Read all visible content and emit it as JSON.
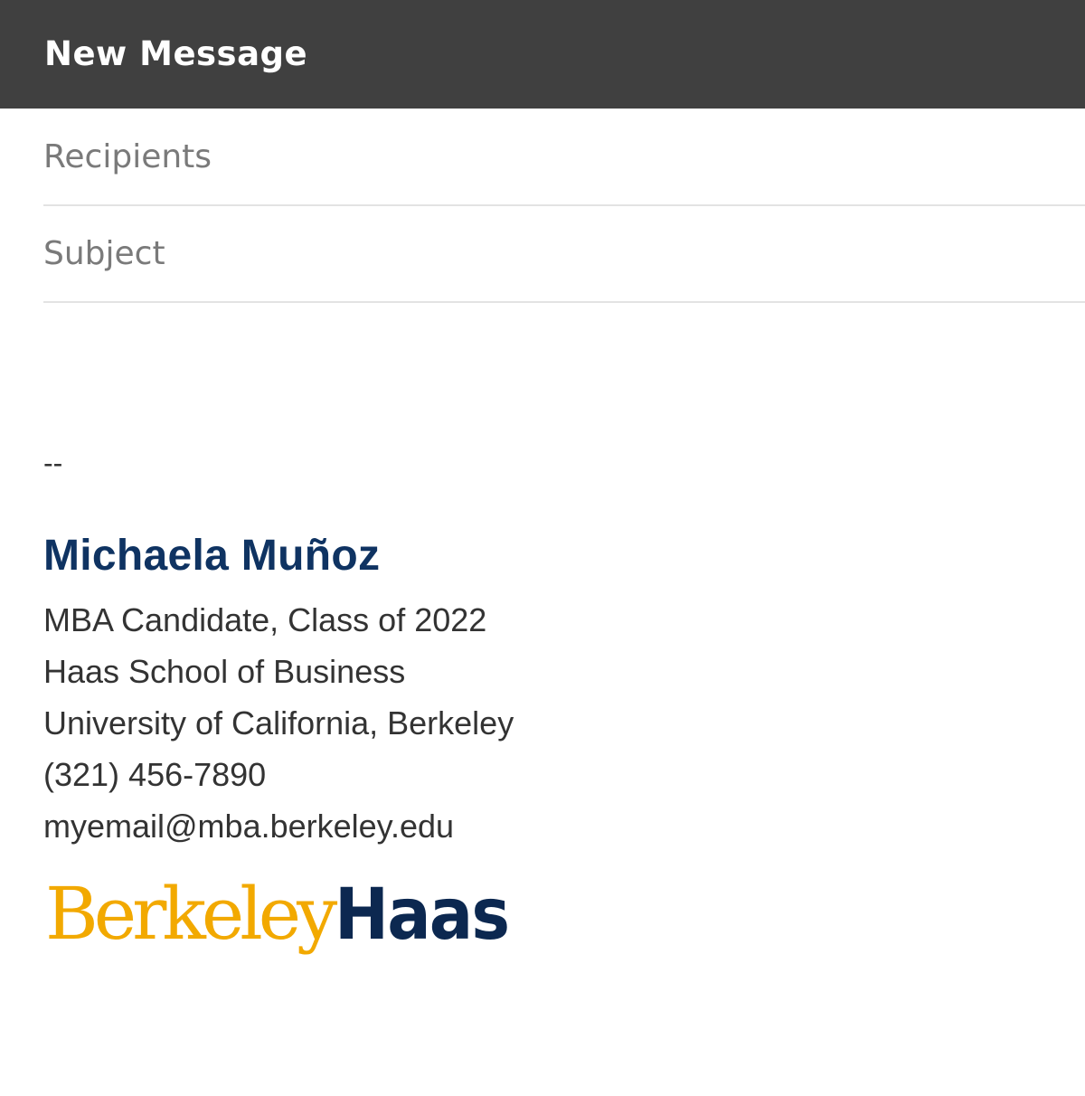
{
  "window": {
    "title": "New Message"
  },
  "compose": {
    "recipients_placeholder": "Recipients",
    "subject_placeholder": "Subject"
  },
  "signature": {
    "separator": "--",
    "name": "Michaela Muñoz",
    "lines": [
      "MBA Candidate, Class of 2022",
      "Haas School of Business",
      "University of California, Berkeley",
      "(321) 456-7890",
      "myemail@mba.berkeley.edu"
    ],
    "logo": {
      "part1": "Berkeley",
      "part2": "Haas",
      "part1_color": "#f2a900",
      "part2_color": "#0c2850"
    },
    "name_color": "#0f3362"
  },
  "colors": {
    "title_bar": "#404040",
    "title_text": "#ffffff",
    "divider": "#e3e3e3",
    "placeholder": "#7a7a7a",
    "body_text": "#333333"
  }
}
